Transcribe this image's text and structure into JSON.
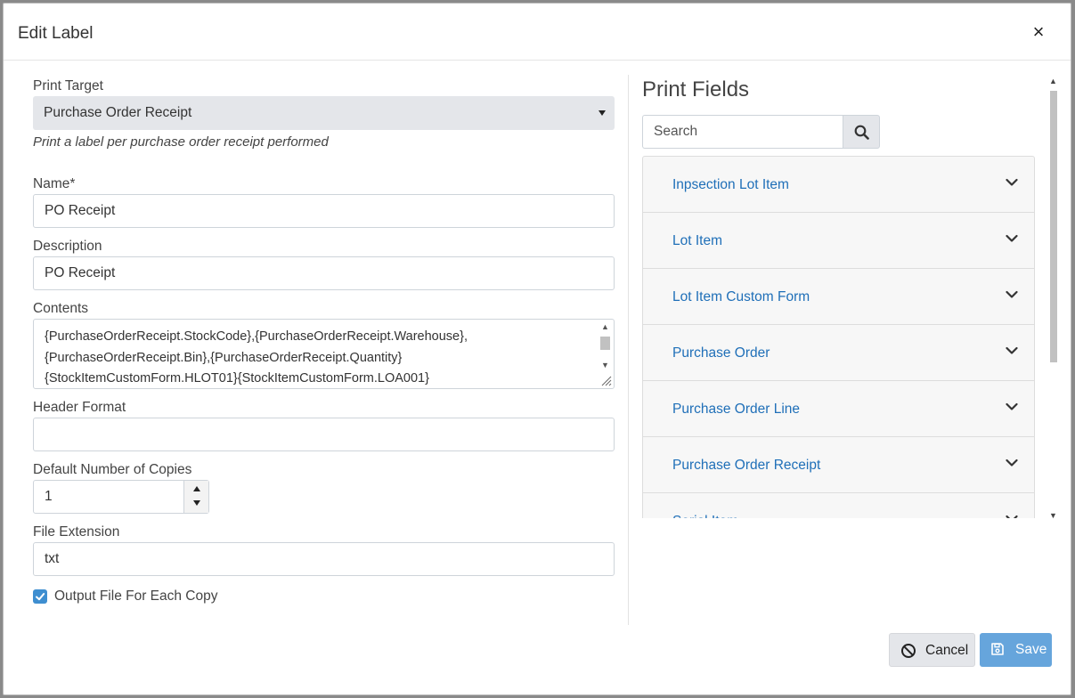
{
  "dialog": {
    "title": "Edit Label",
    "close_symbol": "×"
  },
  "form": {
    "print_target": {
      "label": "Print Target",
      "value": "Purchase Order Receipt",
      "hint": "Print a label per purchase order receipt performed"
    },
    "name": {
      "label": "Name*",
      "value": "PO Receipt"
    },
    "description": {
      "label": "Description",
      "value": "PO Receipt"
    },
    "contents": {
      "label": "Contents",
      "lines": [
        "{PurchaseOrderReceipt.StockCode},{PurchaseOrderReceipt.Warehouse},",
        "{PurchaseOrderReceipt.Bin},{PurchaseOrderReceipt.Quantity}",
        "{StockItemCustomForm.HLOT01}{StockItemCustomForm.LOA001}"
      ]
    },
    "header_format": {
      "label": "Header Format",
      "value": ""
    },
    "default_copies": {
      "label": "Default Number of Copies",
      "value": "1"
    },
    "file_extension": {
      "label": "File Extension",
      "value": "txt"
    },
    "output_each_copy": {
      "label": "Output File For Each Copy",
      "checked": true
    }
  },
  "print_fields": {
    "title": "Print Fields",
    "search_placeholder": "Search",
    "items": [
      "Inpsection Lot Item",
      "Lot Item",
      "Lot Item Custom Form",
      "Purchase Order",
      "Purchase Order Line",
      "Purchase Order Receipt",
      "Serial Item"
    ]
  },
  "footer": {
    "cancel_label": "Cancel",
    "save_label": "Save"
  },
  "colors": {
    "accent": "#3e8ed0",
    "link": "#1f6fb8",
    "save_button": "#66a5dc"
  }
}
